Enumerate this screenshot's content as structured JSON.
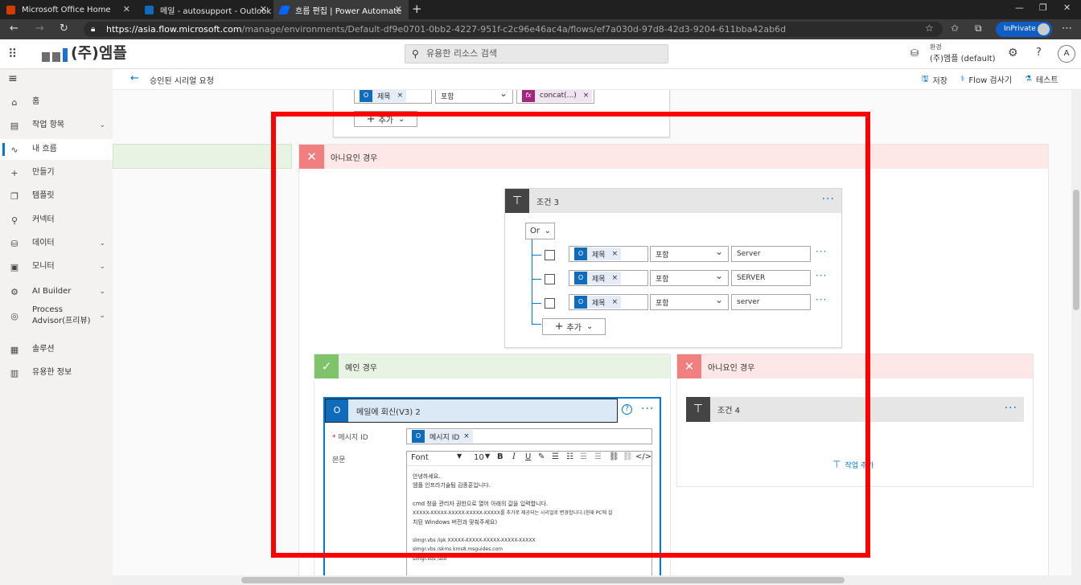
{
  "browser": {
    "tabs": [
      {
        "title": "Microsoft Office Home",
        "color": "#d83b01"
      },
      {
        "title": "메일 - autosupport - Outlook",
        "color": "#0f6cbd"
      },
      {
        "title": "흐름 편집 | Power Automate",
        "color": "#0066ff"
      }
    ],
    "url_main": "https://asia.flow.microsoft.com",
    "url_rest": "/manage/environments/Default-df9e0701-0bb2-4227-951f-c2c96e46ac4a/flows/ef7a030d-97d8-42d3-9204-611bba42ab6d",
    "inprivate": "InPrivate"
  },
  "header": {
    "logo_text": "(주)엠플",
    "search_placeholder": "유용한 리소스 검색",
    "env_label": "환경",
    "env_name": "(주)엠플 (default)",
    "avatar": "A"
  },
  "command_bar": {
    "flow_title": "승인된 시리얼 요청",
    "save": "저장",
    "checker": "Flow 검사기",
    "test": "테스트"
  },
  "nav": [
    {
      "label": "홈",
      "icon": "home-icon",
      "glyph": "⌂",
      "chev": false
    },
    {
      "label": "작업 항목",
      "icon": "clipboard-icon",
      "glyph": "▤",
      "chev": true
    },
    {
      "label": "내 흐름",
      "icon": "flow-icon",
      "glyph": "∿",
      "chev": false,
      "selected": true
    },
    {
      "label": "만들기",
      "icon": "plus-icon",
      "glyph": "+",
      "chev": false
    },
    {
      "label": "템플릿",
      "icon": "template-icon",
      "glyph": "❐",
      "chev": false
    },
    {
      "label": "커넥터",
      "icon": "connector-icon",
      "glyph": "⚲",
      "chev": false
    },
    {
      "label": "데이터",
      "icon": "database-icon",
      "glyph": "⛁",
      "chev": true
    },
    {
      "label": "모니터",
      "icon": "monitor-icon",
      "glyph": "▣",
      "chev": true
    },
    {
      "label": "AI Builder",
      "icon": "ai-builder-icon",
      "glyph": "⚙",
      "chev": true
    },
    {
      "label": "Process Advisor(프리뷰)",
      "icon": "process-advisor-icon",
      "glyph": "◎",
      "chev": true
    },
    {
      "label": "솔루션",
      "icon": "solution-icon",
      "glyph": "▦",
      "chev": false
    },
    {
      "label": "유용한 정보",
      "icon": "book-icon",
      "glyph": "▥",
      "chev": false
    }
  ],
  "top_condition": {
    "chip": "제목",
    "operator": "포함",
    "value_chip": "concat(...)",
    "add": "추가"
  },
  "no_branch": {
    "label": "아니요인 경우"
  },
  "condition3": {
    "title": "조건 3",
    "group": "Or",
    "rows": [
      {
        "chip": "제목",
        "operator": "포함",
        "value": "Server"
      },
      {
        "chip": "제목",
        "operator": "포함",
        "value": "SERVER"
      },
      {
        "chip": "제목",
        "operator": "포함",
        "value": "server"
      }
    ],
    "add": "추가"
  },
  "yes_branch": {
    "label": "예인 경우"
  },
  "no_branch2": {
    "label": "아니요인 경우"
  },
  "reply_card": {
    "title": "메일에 회신(V3) 2",
    "message_id_label": "메시지 ID",
    "message_id_chip": "메시지 ID",
    "body_label": "본문",
    "font": "Font",
    "size": "10",
    "body_lines": [
      "안녕하세요.",
      "엠플 인프라기술팀 김종훈입니다.",
      "",
      "cmd 창을 관리자 권한으로 열어 아래의 값을 입력합니다.",
      "XXXXX-XXXXX-XXXXX-XXXXX-XXXXX를 추가로 제공되는 시리얼로 변경합니다.(현재 PC에 설",
      "치된 Windows 버전과 맞춰주세요)",
      "",
      "slmgr.vbs /ipk XXXXX-XXXXX-XXXXX-XXXXX-XXXXX",
      "slmgr.vbs /skms kms8.msguides.com",
      "slmgr.vbs /ato"
    ]
  },
  "condition4": {
    "title": "조건 4",
    "add_action": "작업 추가"
  }
}
